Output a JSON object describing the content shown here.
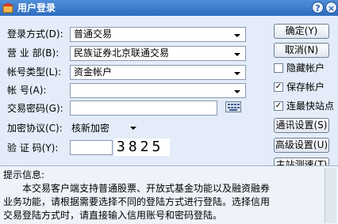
{
  "window": {
    "title": "用户登录",
    "help": "?",
    "close": "×"
  },
  "labels": {
    "login_mode": "登录方式(D):",
    "branch": "营 业 部(B):",
    "account_type": "帐号类型(L):",
    "account": "帐    号(A):",
    "password": "交易密码(G):",
    "encryption": "加密协议(C):",
    "captcha": "验 证 码(Y):"
  },
  "fields": {
    "login_mode": "普通交易",
    "branch": "民族证券北京联通交易",
    "account_type": "资金帐户",
    "account": "",
    "password": "",
    "encryption": "核新加密",
    "captcha_input": "",
    "captcha_code": "3825"
  },
  "buttons": {
    "ok": "确定(Y)",
    "cancel": "取消(N)",
    "comm": "通讯设置(S)",
    "advanced": "高级设置(U)",
    "speed": "主站测速(T)"
  },
  "checks": {
    "hide_account": {
      "label": "隐藏帐户",
      "checked": false,
      "mark": ""
    },
    "save_account": {
      "label": "保存帐户",
      "checked": true,
      "mark": "✓"
    },
    "fastest": {
      "label": "连最快站点",
      "checked": true,
      "mark": "✓"
    }
  },
  "tip": {
    "heading": "提示信息:",
    "text": "本交易客户端支持普通股票、开放式基金功能以及融资融券业务功能，请根据需要选择不同的登陆方式进行登陆。选择信用交易登陆方式时，请直接输入信用账号和密码登陆。"
  },
  "colors": {
    "titlebar": "#2d6cc0",
    "window": "#e3ecf8"
  }
}
